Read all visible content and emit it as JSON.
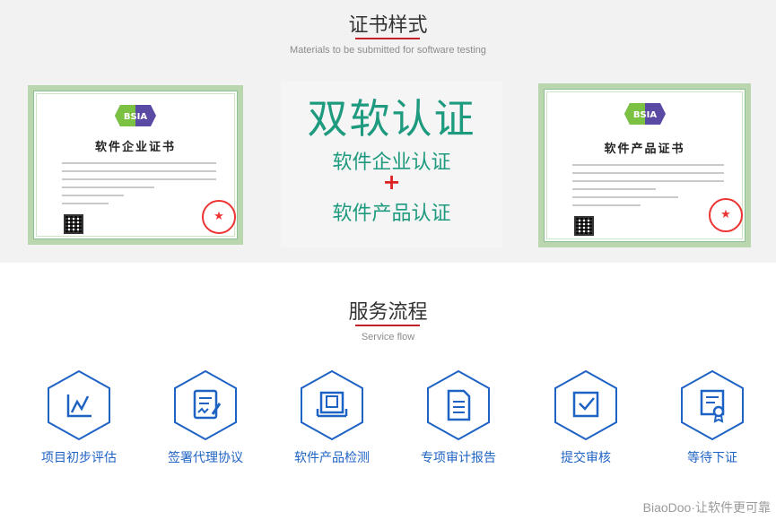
{
  "cert_section": {
    "title": "证书样式",
    "subtitle": "Materials to be submitted for software testing"
  },
  "cert_left": {
    "logo_text": "BSIA",
    "heading": "软件企业证书"
  },
  "cert_right": {
    "logo_text": "BSIA",
    "heading": "软件产品证书"
  },
  "center_panel": {
    "title": "双软认证",
    "line1": "软件企业认证",
    "plus": "+",
    "line2": "软件产品认证"
  },
  "flow_section": {
    "title": "服务流程",
    "subtitle": "Service flow",
    "steps": [
      {
        "label": "项目初步评估",
        "icon": "chart-line-icon"
      },
      {
        "label": "签署代理协议",
        "icon": "sign-document-icon"
      },
      {
        "label": "软件产品检测",
        "icon": "monitor-test-icon"
      },
      {
        "label": "专项审计报告",
        "icon": "report-document-icon"
      },
      {
        "label": "提交审核",
        "icon": "checkbox-submit-icon"
      },
      {
        "label": "等待下证",
        "icon": "certificate-award-icon"
      }
    ]
  },
  "watermark": "BiaoDoo·让软件更可靠",
  "colors": {
    "accent_blue": "#1e63c4",
    "teal": "#1e9a7f",
    "red": "#c4202a"
  }
}
